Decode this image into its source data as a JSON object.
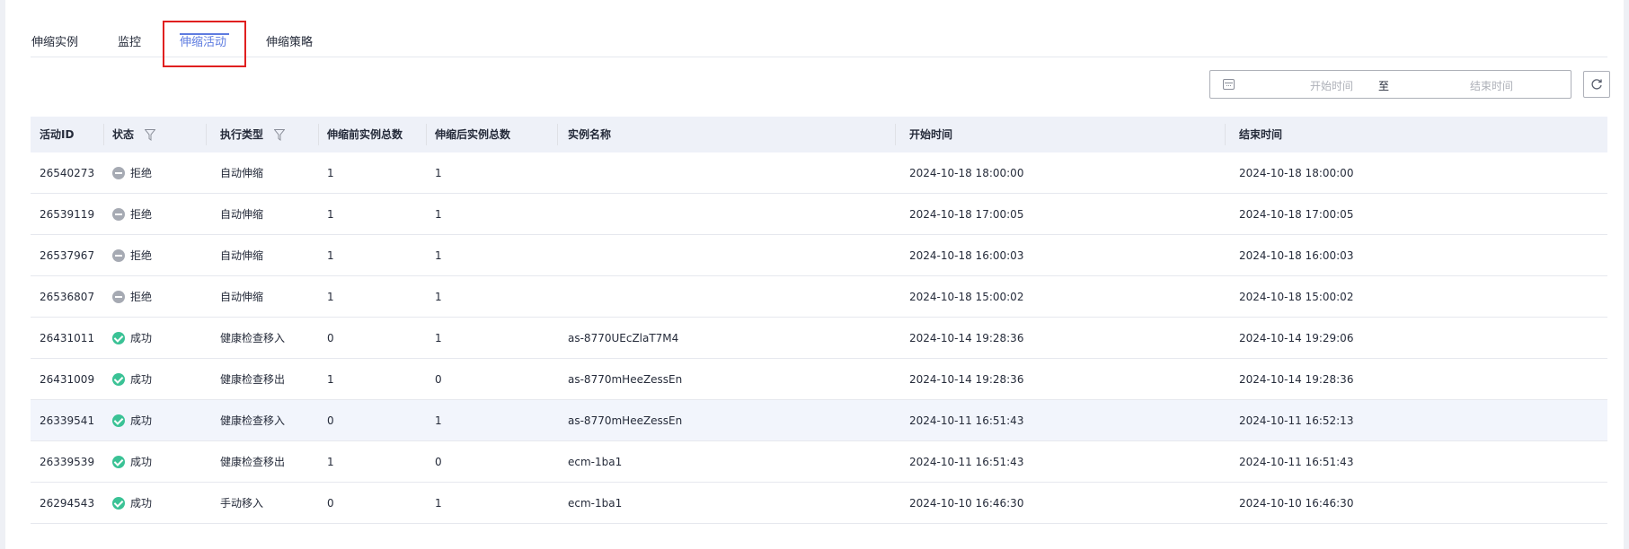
{
  "tabs": [
    {
      "label": "伸缩实例",
      "active": false
    },
    {
      "label": "监控",
      "active": false
    },
    {
      "label": "伸缩活动",
      "active": true
    },
    {
      "label": "伸缩策略",
      "active": false
    }
  ],
  "date_range": {
    "start_placeholder": "开始时间",
    "separator": "至",
    "end_placeholder": "结束时间"
  },
  "table": {
    "headers": [
      "活动ID",
      "状态",
      "执行类型",
      "伸缩前实例总数",
      "伸缩后实例总数",
      "实例名称",
      "开始时间",
      "结束时间"
    ],
    "rows": [
      {
        "id": "26540273",
        "status": "拒绝",
        "status_type": "rejected",
        "type": "自动伸缩",
        "before": "1",
        "after": "1",
        "instance": "",
        "start": "2024-10-18 18:00:00",
        "end": "2024-10-18 18:00:00"
      },
      {
        "id": "26539119",
        "status": "拒绝",
        "status_type": "rejected",
        "type": "自动伸缩",
        "before": "1",
        "after": "1",
        "instance": "",
        "start": "2024-10-18 17:00:05",
        "end": "2024-10-18 17:00:05"
      },
      {
        "id": "26537967",
        "status": "拒绝",
        "status_type": "rejected",
        "type": "自动伸缩",
        "before": "1",
        "after": "1",
        "instance": "",
        "start": "2024-10-18 16:00:03",
        "end": "2024-10-18 16:00:03"
      },
      {
        "id": "26536807",
        "status": "拒绝",
        "status_type": "rejected",
        "type": "自动伸缩",
        "before": "1",
        "after": "1",
        "instance": "",
        "start": "2024-10-18 15:00:02",
        "end": "2024-10-18 15:00:02"
      },
      {
        "id": "26431011",
        "status": "成功",
        "status_type": "success",
        "type": "健康检查移入",
        "before": "0",
        "after": "1",
        "instance": "as-8770UEcZlaT7M4",
        "start": "2024-10-14 19:28:36",
        "end": "2024-10-14 19:29:06"
      },
      {
        "id": "26431009",
        "status": "成功",
        "status_type": "success",
        "type": "健康检查移出",
        "before": "1",
        "after": "0",
        "instance": "as-8770mHeeZessEn",
        "start": "2024-10-14 19:28:36",
        "end": "2024-10-14 19:28:36"
      },
      {
        "id": "26339541",
        "status": "成功",
        "status_type": "success",
        "type": "健康检查移入",
        "before": "0",
        "after": "1",
        "instance": "as-8770mHeeZessEn",
        "start": "2024-10-11 16:51:43",
        "end": "2024-10-11 16:52:13",
        "hovered": true
      },
      {
        "id": "26339539",
        "status": "成功",
        "status_type": "success",
        "type": "健康检查移出",
        "before": "1",
        "after": "0",
        "instance": "ecm-1ba1",
        "start": "2024-10-11 16:51:43",
        "end": "2024-10-11 16:51:43"
      },
      {
        "id": "26294543",
        "status": "成功",
        "status_type": "success",
        "type": "手动移入",
        "before": "0",
        "after": "1",
        "instance": "ecm-1ba1",
        "start": "2024-10-10 16:46:30",
        "end": "2024-10-10 16:46:30"
      }
    ]
  },
  "colors": {
    "accent": "#5e7ce0",
    "success": "#3ac295",
    "rejected": "#a6aab3",
    "header_bg": "#eef1f8",
    "highlight_box": "#e02020"
  },
  "icons": {
    "calendar": "calendar-icon",
    "refresh": "refresh-icon",
    "filter": "filter-icon"
  }
}
